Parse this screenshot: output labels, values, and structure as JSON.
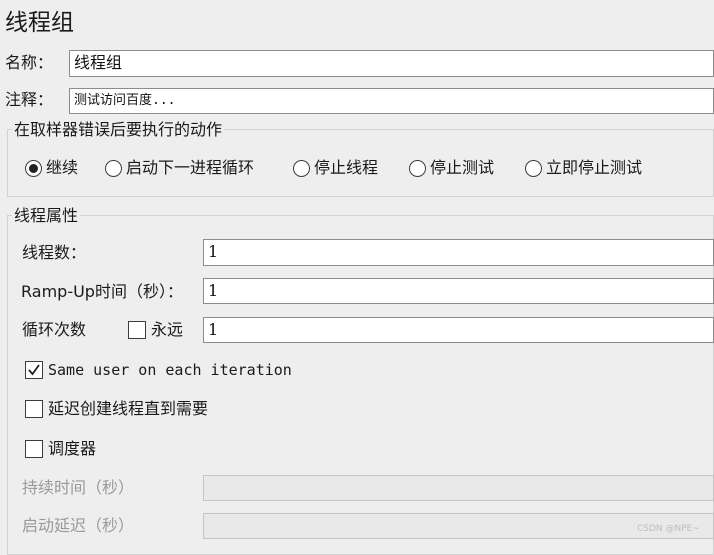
{
  "panel_title": "线程组",
  "name": {
    "label": "名称：",
    "value": "线程组"
  },
  "comment": {
    "label": "注释：",
    "value": "测试访问百度..."
  },
  "sampler_error": {
    "legend": "在取样器错误后要执行的动作",
    "options": [
      "继续",
      "启动下一进程循环",
      "停止线程",
      "停止测试",
      "立即停止测试"
    ],
    "selected": "继续"
  },
  "thread_props": {
    "legend": "线程属性",
    "threads": {
      "label": "线程数：",
      "value": "1"
    },
    "rampup": {
      "label": "Ramp-Up时间（秒）：",
      "value": "1"
    },
    "loop": {
      "label": "循环次数",
      "forever_label": "永远",
      "forever_checked": false,
      "value": "1"
    },
    "same_user": {
      "label": "Same user on each iteration",
      "checked": true
    },
    "delay_create": {
      "label": "延迟创建线程直到需要",
      "checked": false
    },
    "scheduler": {
      "label": "调度器",
      "checked": false
    },
    "duration": {
      "label": "持续时间（秒）",
      "value": ""
    },
    "startup_delay": {
      "label": "启动延迟（秒）",
      "value": ""
    }
  },
  "watermark": "CSDN @NPE~"
}
